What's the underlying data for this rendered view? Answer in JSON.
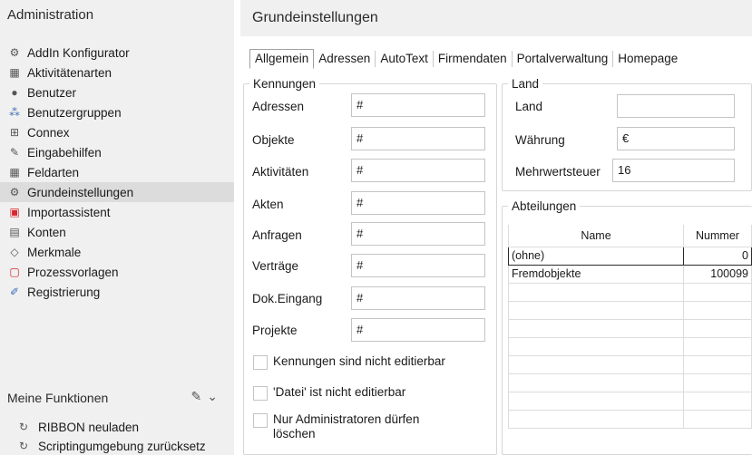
{
  "sidebar": {
    "title": "Administration",
    "items": [
      {
        "label": "AddIn Konfigurator",
        "icon": "addin-icon"
      },
      {
        "label": "Aktivitätenarten",
        "icon": "activity-icon"
      },
      {
        "label": "Benutzer",
        "icon": "user-icon"
      },
      {
        "label": "Benutzergruppen",
        "icon": "usergroup-icon"
      },
      {
        "label": "Connex",
        "icon": "connex-icon"
      },
      {
        "label": "Eingabehilfen",
        "icon": "input-help-icon"
      },
      {
        "label": "Feldarten",
        "icon": "fieldtype-icon"
      },
      {
        "label": "Grundeinstellungen",
        "icon": "settings-icon"
      },
      {
        "label": "Importassistent",
        "icon": "import-icon"
      },
      {
        "label": "Konten",
        "icon": "account-icon"
      },
      {
        "label": "Merkmale",
        "icon": "tag-icon"
      },
      {
        "label": "Prozessvorlagen",
        "icon": "process-template-icon"
      },
      {
        "label": "Registrierung",
        "icon": "registration-icon"
      }
    ],
    "selected_index": 7,
    "functions": {
      "title": "Meine Funktionen",
      "items": [
        {
          "label": "RIBBON neuladen",
          "icon": "reload-icon"
        },
        {
          "label": "Scriptingumgebung zurücksetz",
          "icon": "reset-icon"
        }
      ]
    }
  },
  "main": {
    "title": "Grundeinstellungen",
    "tabs": [
      "Allgemein",
      "Adressen",
      "AutoText",
      "Firmendaten",
      "Portalverwaltung",
      "Homepage"
    ],
    "active_tab": "Allgemein",
    "kennungen": {
      "legend": "Kennungen",
      "rows": [
        {
          "label": "Adressen",
          "value": "#"
        },
        {
          "label": "Objekte",
          "value": "#"
        },
        {
          "label": "Aktivitäten",
          "value": "#"
        },
        {
          "label": "Akten",
          "value": "#"
        },
        {
          "label": "Anfragen",
          "value": "#"
        },
        {
          "label": "Verträge",
          "value": "#"
        },
        {
          "label": "Dok.Eingang",
          "value": "#"
        },
        {
          "label": "Projekte",
          "value": "#"
        }
      ],
      "checks": [
        {
          "label": "Kennungen sind nicht editierbar",
          "checked": false
        },
        {
          "label": "'Datei' ist nicht editierbar",
          "checked": false
        },
        {
          "label": "Nur Administratoren dürfen löschen",
          "checked": false
        }
      ]
    },
    "land": {
      "legend": "Land",
      "rows": [
        {
          "label": "Land",
          "value": ""
        },
        {
          "label": "Währung",
          "value": "€"
        },
        {
          "label": "Mehrwertsteuer",
          "value": "16"
        }
      ]
    },
    "abteilungen": {
      "legend": "Abteilungen",
      "columns": [
        "Name",
        "Nummer"
      ],
      "rows": [
        {
          "name": "(ohne)",
          "nummer": "0"
        },
        {
          "name": "Fremdobjekte",
          "nummer": "100099"
        }
      ],
      "empty_rows": 8
    }
  }
}
